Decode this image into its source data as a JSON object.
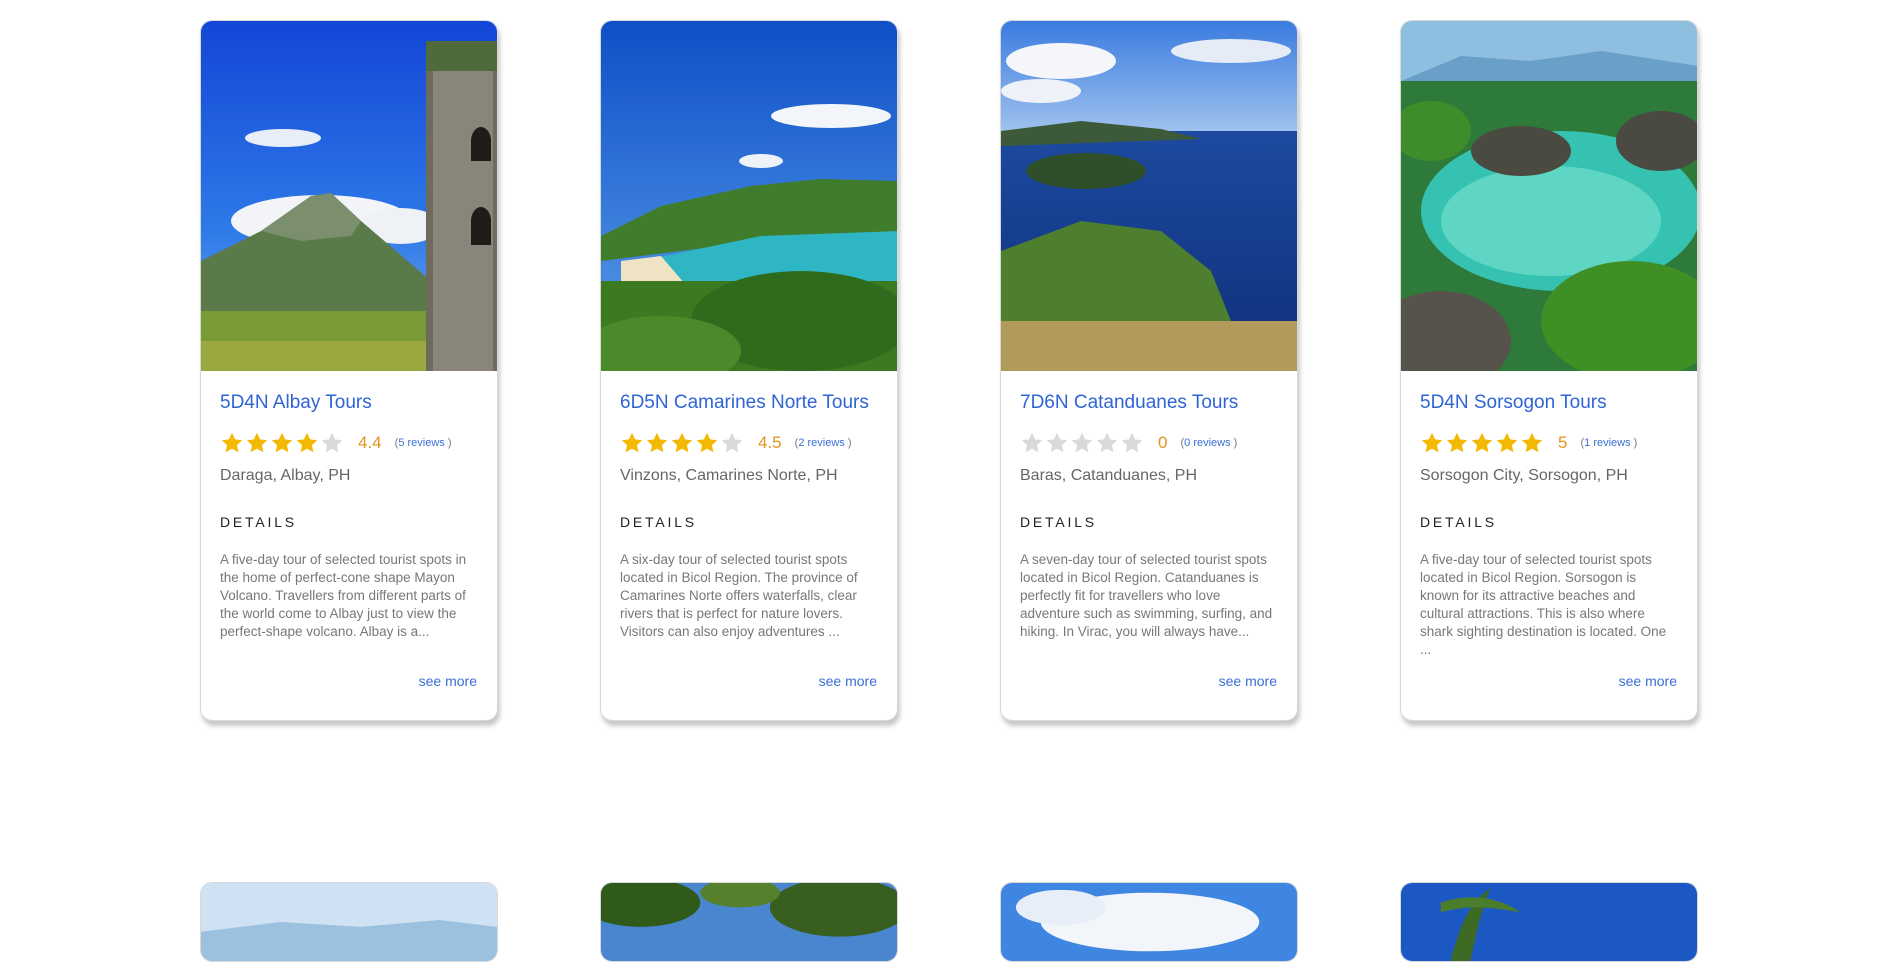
{
  "tours": [
    {
      "title": "5D4N Albay Tours",
      "rating_stars": 4,
      "score": "4.4",
      "reviews_open": "(",
      "reviews_link": "5 reviews",
      "reviews_close": ")",
      "location": "Daraga, Albay, PH",
      "details_heading": "DETAILS",
      "description": "A five-day tour of selected tourist spots in the home of perfect-cone shape Mayon Volcano. Travellers from different parts of the world come to Albay just to view the perfect-shape volcano. Albay is a...",
      "see_more": "see more"
    },
    {
      "title": "6D5N Camarines Norte Tours",
      "rating_stars": 4,
      "score": "4.5",
      "reviews_open": "(",
      "reviews_link": "2 reviews",
      "reviews_close": ")",
      "location": "Vinzons, Camarines Norte, PH",
      "details_heading": "DETAILS",
      "description": "A six-day tour of selected tourist spots located in Bicol Region. The province of Camarines Norte offers waterfalls, clear rivers that is perfect for nature lovers. Visitors can also enjoy adventures ...",
      "see_more": "see more"
    },
    {
      "title": "7D6N Catanduanes Tours",
      "rating_stars": 0,
      "score": "0",
      "reviews_open": "(",
      "reviews_link": "0 reviews",
      "reviews_close": ")",
      "location": "Baras, Catanduanes, PH",
      "details_heading": "DETAILS",
      "description": "A seven-day tour of selected tourist spots located in Bicol Region. Catanduanes is perfectly fit for travellers who love adventure such as swimming, surfing, and hiking. In Virac, you will always have...",
      "see_more": "see more"
    },
    {
      "title": "5D4N Sorsogon Tours",
      "rating_stars": 5,
      "score": "5",
      "reviews_open": "(",
      "reviews_link": "1 reviews",
      "reviews_close": ")",
      "location": "Sorsogon City, Sorsogon, PH",
      "details_heading": "DETAILS",
      "description": "A five-day tour of selected tourist spots located in Bicol Region. Sorsogon is known for its attractive beaches and cultural attractions. This is also where shark sighting destination is located. One ...",
      "see_more": "see more"
    }
  ],
  "colors": {
    "title_blue": "#2f64d6",
    "star_filled": "#f5b800",
    "star_empty": "#d9d9d9",
    "score_orange": "#e4931b",
    "link_blue": "#3b6fd6"
  },
  "icons": {
    "star": "star-icon"
  }
}
